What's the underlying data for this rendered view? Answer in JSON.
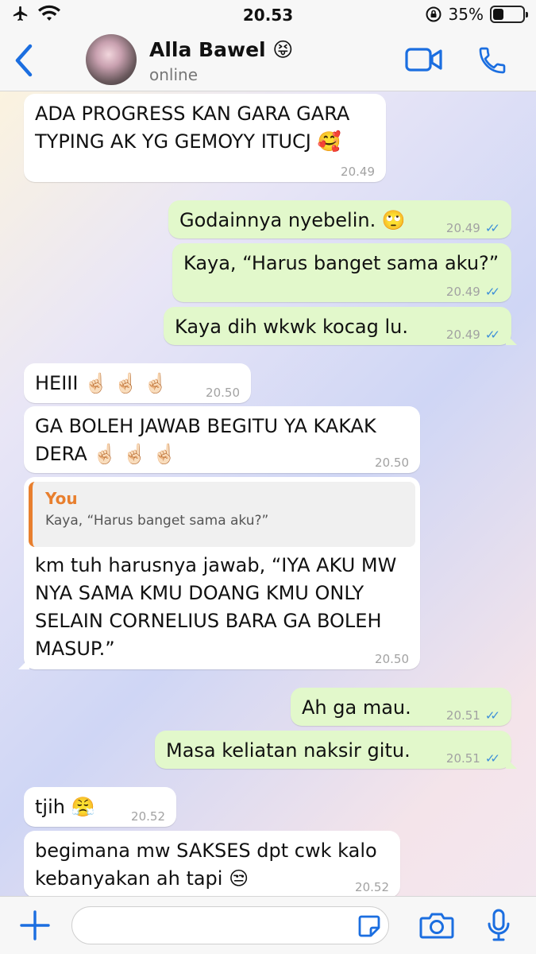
{
  "status": {
    "time": "20.53",
    "battery": "35%",
    "battery_level": 0.35
  },
  "header": {
    "name": "Alla Bawel 😝",
    "status": "online"
  },
  "messages": [
    {
      "line1": "ADA PROGRESS KAN GARA GARA",
      "line2": "TYPING AK YG GEMOYY ITUCJ 🥰",
      "time": "20.49"
    },
    {
      "text": "Godainnya nyebelin. 🙄",
      "time": "20.49"
    },
    {
      "text": "Kaya, “Harus banget sama aku?”",
      "time": "20.49"
    },
    {
      "text": "Kaya dih wkwk kocag lu.",
      "time": "20.49"
    },
    {
      "text": "HEIII ☝🏻 ☝🏻 ☝🏻",
      "time": "20.50"
    },
    {
      "line1": "GA BOLEH JAWAB BEGITU YA KAKAK",
      "line2": "DERA ☝🏻 ☝🏻 ☝🏻",
      "time": "20.50"
    },
    {
      "quote_author": "You",
      "quote_text": "Kaya, “Harus banget sama aku?”",
      "line1": "km tuh harusnya jawab, “IYA AKU MW",
      "line2": "NYA SAMA KMU DOANG KMU ONLY",
      "line3": "SELAIN CORNELIUS BARA GA BOLEH",
      "line4": "MASUP.”",
      "time": "20.50"
    },
    {
      "text": "Ah ga mau.",
      "time": "20.51"
    },
    {
      "text": "Masa keliatan naksir gitu.",
      "time": "20.51"
    },
    {
      "text": "tjih 😤",
      "time": "20.52"
    },
    {
      "line1": "begimana mw SAKSES dpt cwk kalo",
      "line2": "kebanyakan ah tapi 😒",
      "time": "20.52"
    }
  ],
  "icons": {
    "back": "chevron-left-icon",
    "video": "video-icon",
    "call": "phone-icon",
    "plus": "plus-icon",
    "sticker": "sticker-icon",
    "camera": "camera-icon",
    "mic": "mic-icon",
    "ticks": "read-receipt-icon"
  },
  "colors": {
    "accent": "#1b6ee0",
    "outgoing": "#e2f8cb",
    "incoming": "#ffffff",
    "quote_author": "#e87f2e",
    "read_ticks": "#3d8ed8"
  }
}
